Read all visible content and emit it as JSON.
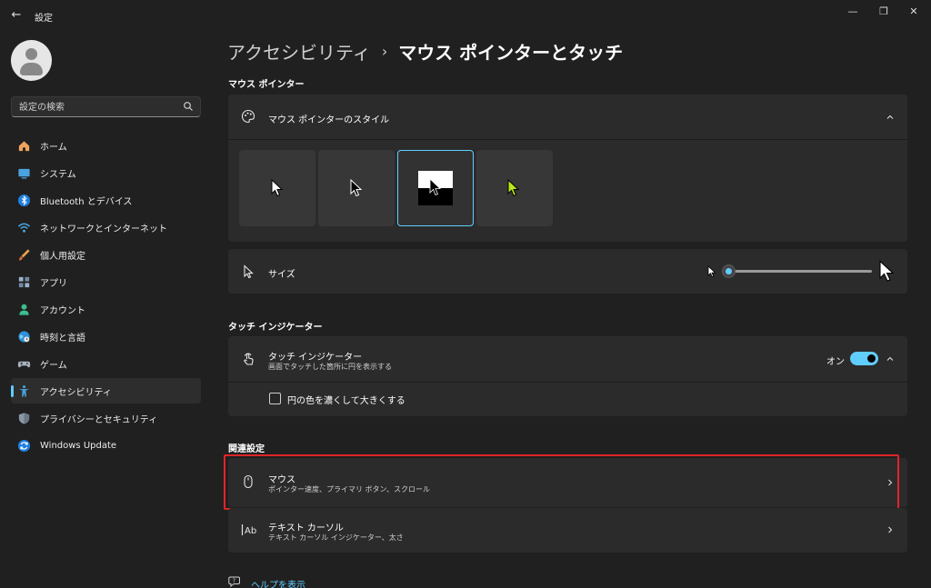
{
  "window": {
    "title": "設定",
    "back_glyph": "←",
    "controls": {
      "minimize": "—",
      "maximize": "❐",
      "close": "✕"
    }
  },
  "search": {
    "placeholder": "設定の検索"
  },
  "sidebar": {
    "items": [
      {
        "label": "ホーム",
        "icon": "home-icon"
      },
      {
        "label": "システム",
        "icon": "system-icon"
      },
      {
        "label": "Bluetooth とデバイス",
        "icon": "bluetooth-icon"
      },
      {
        "label": "ネットワークとインターネット",
        "icon": "network-icon"
      },
      {
        "label": "個人用設定",
        "icon": "brush-icon"
      },
      {
        "label": "アプリ",
        "icon": "apps-icon"
      },
      {
        "label": "アカウント",
        "icon": "account-icon"
      },
      {
        "label": "時刻と言語",
        "icon": "globe-clock-icon"
      },
      {
        "label": "ゲーム",
        "icon": "gamepad-icon"
      },
      {
        "label": "アクセシビリティ",
        "icon": "accessibility-icon",
        "active": true
      },
      {
        "label": "プライバシーとセキュリティ",
        "icon": "shield-icon"
      },
      {
        "label": "Windows Update",
        "icon": "update-icon"
      }
    ]
  },
  "breadcrumb": {
    "parent": "アクセシビリティ",
    "separator": "›",
    "current": "マウス ポインターとタッチ"
  },
  "mouse_pointer": {
    "header": "マウス ポインター",
    "style_title": "マウス ポインターのスタイル",
    "styles": [
      "white",
      "black",
      "inverted",
      "custom"
    ],
    "selected_style": "inverted",
    "size_label": "サイズ",
    "size_value": 0.0
  },
  "touch": {
    "header": "タッチ インジケーター",
    "indicator_title": "タッチ インジケーター",
    "indicator_desc": "画面でタッチした箇所に円を表示する",
    "toggle_label": "オン",
    "toggle_on": true,
    "darker_label": "円の色を濃くして大きくする",
    "darker_checked": false
  },
  "related": {
    "header": "関連設定",
    "mouse_title": "マウス",
    "mouse_desc": "ポインター速度、プライマリ ボタン、スクロール",
    "text_cursor_title": "テキスト カーソル",
    "text_cursor_desc": "テキスト カーソル インジケーター、太さ"
  },
  "help": {
    "label": "ヘルプを表示"
  },
  "colors": {
    "accent": "#60cdff",
    "highlight": "#e0242a",
    "background": "#202020",
    "card": "#2b2b2b"
  }
}
